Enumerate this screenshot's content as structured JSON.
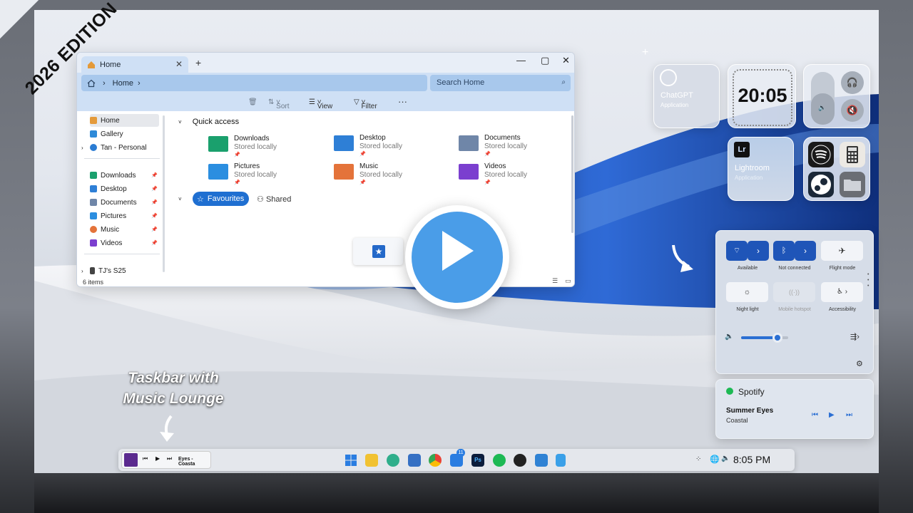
{
  "ribbon": {
    "text": "2026 EDITION"
  },
  "explorer": {
    "tab_title": "Home",
    "new_tab": "+",
    "breadcrumb": [
      "Home"
    ],
    "search_placeholder": "Search Home",
    "toolbar": {
      "sort": "Sort",
      "view": "View",
      "filter": "Filter",
      "more": "···"
    },
    "nav": {
      "top": [
        {
          "label": "Home",
          "icon": "home-icon",
          "active": true
        },
        {
          "label": "Gallery",
          "icon": "gallery-icon"
        },
        {
          "label": "Tan - Personal",
          "icon": "cloud-icon"
        }
      ],
      "pinned": [
        {
          "label": "Downloads",
          "icon": "download-folder-icon"
        },
        {
          "label": "Desktop",
          "icon": "desktop-folder-icon"
        },
        {
          "label": "Documents",
          "icon": "documents-folder-icon"
        },
        {
          "label": "Pictures",
          "icon": "pictures-folder-icon"
        },
        {
          "label": "Music",
          "icon": "music-folder-icon"
        },
        {
          "label": "Videos",
          "icon": "videos-folder-icon"
        }
      ],
      "device": "TJ's S25"
    },
    "quick_access_title": "Quick access",
    "quick_access": [
      {
        "name": "Downloads",
        "status": "Stored locally",
        "color": "#1aa06d"
      },
      {
        "name": "Desktop",
        "status": "Stored locally",
        "color": "#2e7fd6"
      },
      {
        "name": "Documents",
        "status": "Stored locally",
        "color": "#6f86a8"
      },
      {
        "name": "Pictures",
        "status": "Stored locally",
        "color": "#2b8ee0"
      },
      {
        "name": "Music",
        "status": "Stored locally",
        "color": "#e4733a"
      },
      {
        "name": "Videos",
        "status": "Stored locally",
        "color": "#7b3fcf"
      }
    ],
    "favourites_label": "Favourites",
    "shared_label": "Shared",
    "status_items": "6 items"
  },
  "widgets": {
    "chatgpt": {
      "title": "ChatGPT",
      "subtitle": "Application"
    },
    "clock": {
      "time": "20:05"
    },
    "lightroom": {
      "badge": "Lr",
      "title": "Lightroom",
      "subtitle": "Application"
    }
  },
  "quick_settings": {
    "tiles": [
      {
        "label": "Available",
        "icon": "wifi-icon",
        "on": true
      },
      {
        "label": "Not connected",
        "icon": "bluetooth-icon",
        "on": true
      },
      {
        "label": "Flight mode",
        "icon": "airplane-icon",
        "on": false
      },
      {
        "label": "Night light",
        "icon": "sun-icon",
        "on": false
      },
      {
        "label": "Mobile hotspot",
        "icon": "hotspot-icon",
        "on": false,
        "disabled": true
      },
      {
        "label": "Accessibility",
        "icon": "accessibility-icon",
        "on": false
      }
    ],
    "volume_level": 0.7
  },
  "spotify": {
    "app": "Spotify",
    "track": "Summer Eyes",
    "artist": "Coastal"
  },
  "taskbar": {
    "music_now_playing": "Eyes - Coasta",
    "clock": "8:05 PM",
    "badge_count": "11"
  },
  "callout": {
    "line1": "Taskbar with",
    "line2": "Music Lounge"
  },
  "colors": {
    "accent": "#1f6fd1",
    "play_button": "#4a9de8"
  }
}
